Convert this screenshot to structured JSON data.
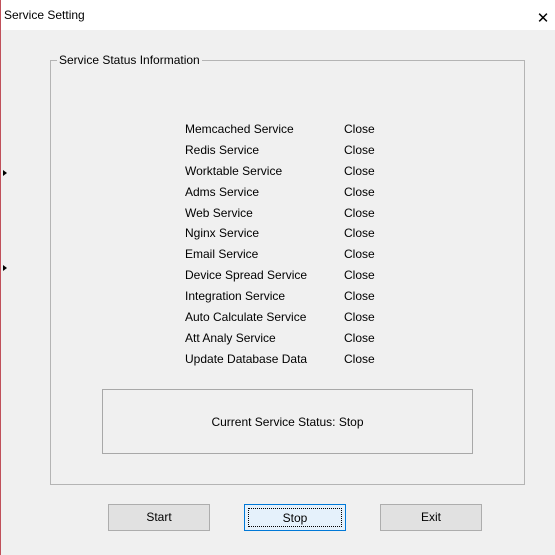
{
  "window": {
    "title": "Service Setting",
    "close_glyph": "✕"
  },
  "group": {
    "label": "Service Status Information"
  },
  "services": [
    {
      "name": "Memcached Service",
      "status": "Close"
    },
    {
      "name": "Redis Service",
      "status": "Close"
    },
    {
      "name": "Worktable Service",
      "status": "Close"
    },
    {
      "name": "Adms Service",
      "status": "Close"
    },
    {
      "name": "Web Service",
      "status": "Close"
    },
    {
      "name": "Nginx Service",
      "status": "Close"
    },
    {
      "name": "Email Service",
      "status": "Close"
    },
    {
      "name": "Device Spread Service",
      "status": "Close"
    },
    {
      "name": "Integration Service",
      "status": "Close"
    },
    {
      "name": "Auto Calculate Service",
      "status": "Close"
    },
    {
      "name": "Att Analy Service",
      "status": "Close"
    },
    {
      "name": "Update Database Data",
      "status": "Close"
    }
  ],
  "current_status": "Current Service Status: Stop",
  "buttons": {
    "start": "Start",
    "stop": "Stop",
    "exit": "Exit"
  },
  "colors": {
    "window_bg": "#f0f0f0",
    "titlebar_bg": "#ffffff",
    "focus_border": "#0078d7",
    "window_left_edge": "#c0505a"
  }
}
